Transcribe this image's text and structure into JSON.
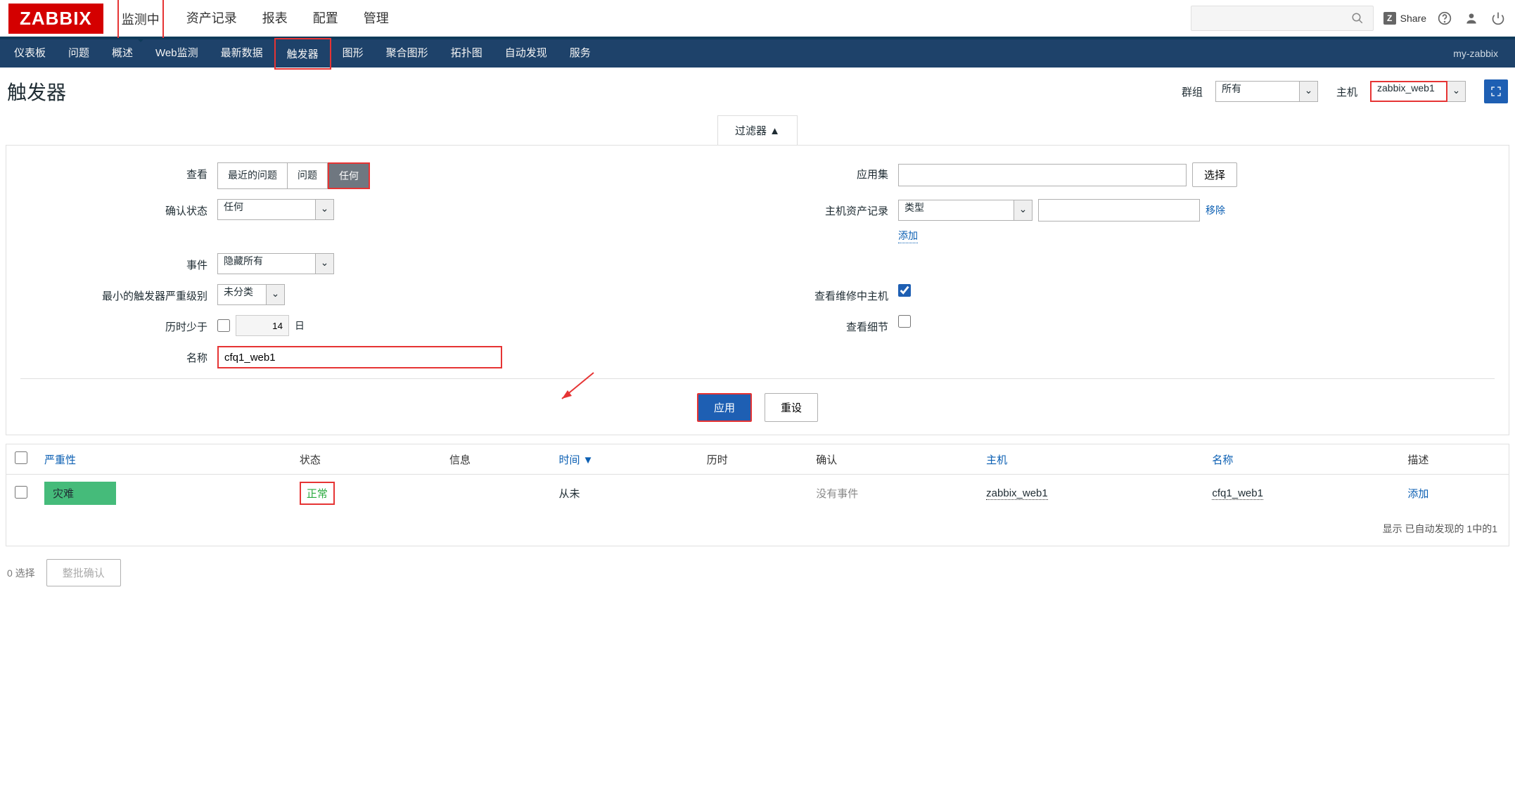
{
  "logo": "ZABBIX",
  "topnav": [
    "监测中",
    "资产记录",
    "报表",
    "配置",
    "管理"
  ],
  "topnav_active_index": 0,
  "share_label": "Share",
  "subnav": [
    "仪表板",
    "问题",
    "概述",
    "Web监测",
    "最新数据",
    "触发器",
    "图形",
    "聚合图形",
    "拓扑图",
    "自动发现",
    "服务"
  ],
  "subnav_active_index": 5,
  "subnav_right": "my-zabbix",
  "page_title": "触发器",
  "header_selects": {
    "group_label": "群组",
    "group_value": "所有",
    "host_label": "主机",
    "host_value": "zabbix_web1"
  },
  "filter_tab": "过滤器 ▲",
  "filters": {
    "view_label": "查看",
    "view_options": [
      "最近的问题",
      "问题",
      "任何"
    ],
    "view_active_index": 2,
    "ack_label": "确认状态",
    "ack_value": "任何",
    "event_label": "事件",
    "event_value": "隐藏所有",
    "min_sev_label": "最小的触发器严重级别",
    "min_sev_value": "未分类",
    "age_label": "历时少于",
    "age_value": "14",
    "age_unit": "日",
    "name_label": "名称",
    "name_value": "cfq1_web1",
    "app_label": "应用集",
    "app_select": "选择",
    "inv_label": "主机资产记录",
    "inv_value": "类型",
    "inv_remove": "移除",
    "inv_add": "添加",
    "maint_label": "查看维修中主机",
    "detail_label": "查看细节",
    "apply": "应用",
    "reset": "重设"
  },
  "table": {
    "headers": {
      "severity": "严重性",
      "status": "状态",
      "info": "信息",
      "time": "时间",
      "time_sort": "▼",
      "duration": "历时",
      "ack": "确认",
      "host": "主机",
      "name": "名称",
      "desc": "描述"
    },
    "row": {
      "severity": "灾难",
      "status": "正常",
      "time": "从未",
      "ack": "没有事件",
      "host": "zabbix_web1",
      "name": "cfq1_web1",
      "desc": "添加"
    },
    "footer": "显示 已自动发现的 1中的1"
  },
  "bottom": {
    "selected": "0 选择",
    "bulk_ack": "整批确认"
  }
}
